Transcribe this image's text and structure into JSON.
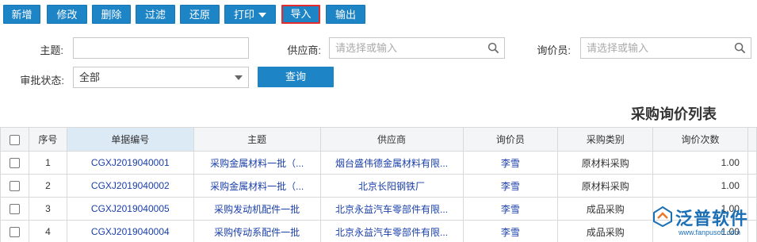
{
  "toolbar": {
    "add": "新增",
    "edit": "修改",
    "delete": "删除",
    "filter": "过滤",
    "restore": "还原",
    "print": "打印",
    "import": "导入",
    "export": "输出"
  },
  "form": {
    "subject_label": "主题:",
    "subject_value": "",
    "supplier_label": "供应商:",
    "supplier_placeholder": "请选择或输入",
    "inquirer_label": "询价员:",
    "inquirer_placeholder": "请选择或输入",
    "status_label": "审批状态:",
    "status_value": "全部",
    "query_button": "查询"
  },
  "report_title": "采购询价列表",
  "table": {
    "headers": [
      "序号",
      "单据编号",
      "主题",
      "供应商",
      "询价员",
      "采购类别",
      "询价次数"
    ],
    "rows": [
      {
        "no": "1",
        "code": "CGXJ2019040001",
        "subject": "采购金属材料一批（...",
        "supplier": "烟台盛伟德金属材料有限...",
        "inquirer": "李雪",
        "category": "原材料采购",
        "count": "1.00"
      },
      {
        "no": "2",
        "code": "CGXJ2019040002",
        "subject": "采购金属材料一批（...",
        "supplier": "北京长阳钢铁厂",
        "inquirer": "李雪",
        "category": "原材料采购",
        "count": "1.00"
      },
      {
        "no": "3",
        "code": "CGXJ2019040005",
        "subject": "采购发动机配件一批",
        "supplier": "北京永益汽车零部件有限...",
        "inquirer": "李雪",
        "category": "成品采购",
        "count": "1.00"
      },
      {
        "no": "4",
        "code": "CGXJ2019040004",
        "subject": "采购传动系配件一批",
        "supplier": "北京永益汽车零部件有限...",
        "inquirer": "李雪",
        "category": "成品采购",
        "count": "1.00"
      }
    ]
  },
  "watermark": {
    "brand": "泛普软件",
    "url": "www.fanpusoft.com"
  },
  "colors": {
    "primary": "#1d84c6",
    "highlight_border": "#e52b2b",
    "link": "#1a3fa8"
  }
}
